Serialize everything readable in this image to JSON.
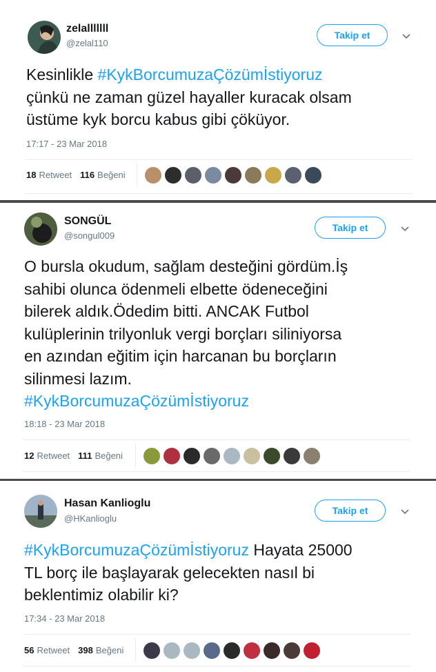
{
  "tweets": [
    {
      "name": "zelalllllll",
      "handle": "@zelal110",
      "follow_label": "Takip et",
      "text_lines": [
        {
          "hashtag": "",
          "before": "Kesinlikle ",
          "tag": "#KykBorcumuzaÇözümİstiyoruz",
          "after": ""
        },
        {
          "before": "çünkü ne zaman güzel hayaller kuracak olsam"
        },
        {
          "before": "üstüme kyk borcu kabus gibi çöküyor."
        }
      ],
      "timestamp": "17:17 - 23 Mar 2018",
      "retweets": "18",
      "retweet_label": "Retweet",
      "likes": "116",
      "likes_label": "Beğeni",
      "avatar_colors": [
        "#3a4a3a",
        "#c8a88a"
      ],
      "faces": [
        "#b9906a",
        "#2d2d2d",
        "#5a5f6a",
        "#7a8aa0",
        "#4a3a3a",
        "#8a7a5a",
        "#c9a84a",
        "#5a6070",
        "#3a4a5a"
      ]
    },
    {
      "name": "SONGÜL",
      "handle": "@songul009",
      "follow_label": "Takip et",
      "text_lines": [
        {
          "before": "O bursla okudum, sağlam desteğini gördüm.İş"
        },
        {
          "before": "sahibi olunca ödenmeli elbette ödeneceğini"
        },
        {
          "before": "bilerek aldık.Ödedim bitti. ANCAK Futbol"
        },
        {
          "before": "kulüplerinin trilyonluk vergi borçları siliniyorsa"
        },
        {
          "before": "en azından eğitim için harcanan bu borçların"
        },
        {
          "before": "silinmesi lazım."
        },
        {
          "before": "",
          "tag": "#KykBorcumuzaÇözümİstiyoruz",
          "after": ""
        }
      ],
      "timestamp": "18:18 - 23 Mar 2018",
      "retweets": "12",
      "retweet_label": "Retweet",
      "likes": "111",
      "likes_label": "Beğeni",
      "avatar_colors": [
        "#5a6a4a",
        "#2a2a2a"
      ],
      "faces": [
        "#8a9a3a",
        "#b03040",
        "#2a2a2a",
        "#6a6a6a",
        "#aab8c2",
        "#c8c0a0",
        "#3a4a2a",
        "#3a3a3a",
        "#8a8070"
      ]
    },
    {
      "name": "Hasan Kanlioglu",
      "handle": "@HKanlioglu",
      "follow_label": "Takip et",
      "text_lines": [
        {
          "before": "",
          "tag": "#KykBorcumuzaÇözümİstiyoruz",
          "after": " Hayata 25000"
        },
        {
          "before": "TL borç ile başlayarak gelecekten nasıl bi"
        },
        {
          "before": "beklentimiz olabilir ki?"
        }
      ],
      "timestamp": "17:34 - 23 Mar 2018",
      "retweets": "56",
      "retweet_label": "Retweet",
      "likes": "398",
      "likes_label": "Beğeni",
      "avatar_colors": [
        "#8aa0b8",
        "#3a4a5a"
      ],
      "faces": [
        "#3a3a4a",
        "#aab8c2",
        "#aab8c2",
        "#5a6a8a",
        "#2a2a2a",
        "#c03040",
        "#3a2a2a",
        "#4a3a3a",
        "#c02030"
      ]
    }
  ],
  "icons": {
    "caret": "chevron-down-icon"
  }
}
